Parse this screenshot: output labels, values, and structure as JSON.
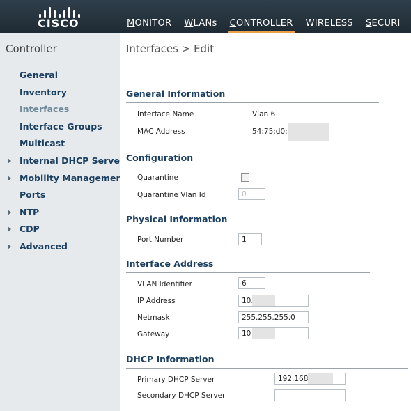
{
  "brand": {
    "name": "CISCO"
  },
  "nav": [
    {
      "label": "MONITOR",
      "accel": "M",
      "rest": "ONITOR"
    },
    {
      "label": "WLANs",
      "accel": "W",
      "rest": "LANs"
    },
    {
      "label": "CONTROLLER",
      "accel": "C",
      "rest": "ONTROLLER"
    },
    {
      "label": "WIRELESS",
      "accel": "W",
      "rest": "IRELESS",
      "accel_pos": "I"
    },
    {
      "label": "SECURI",
      "accel": "S",
      "rest": "ECURI"
    }
  ],
  "sidebar": {
    "title": "Controller",
    "items": [
      {
        "label": "General",
        "expandable": false
      },
      {
        "label": "Inventory",
        "expandable": false
      },
      {
        "label": "Interfaces",
        "expandable": false,
        "current": true
      },
      {
        "label": "Interface Groups",
        "expandable": false
      },
      {
        "label": "Multicast",
        "expandable": false
      },
      {
        "label": "Internal DHCP Server",
        "expandable": true
      },
      {
        "label": "Mobility Management",
        "expandable": true
      },
      {
        "label": "Ports",
        "expandable": false
      },
      {
        "label": "NTP",
        "expandable": true
      },
      {
        "label": "CDP",
        "expandable": true
      },
      {
        "label": "Advanced",
        "expandable": true
      }
    ]
  },
  "page": {
    "title": "Interfaces > Edit"
  },
  "general": {
    "heading": "General Information",
    "interface_name_label": "Interface Name",
    "interface_name_value": "Vlan 6",
    "mac_label": "MAC Address",
    "mac_value": "54:75:d0:"
  },
  "configuration": {
    "heading": "Configuration",
    "quarantine_label": "Quarantine",
    "quarantine_checked": false,
    "quarantine_vlan_label": "Quarantine Vlan Id",
    "quarantine_vlan_value": "0"
  },
  "physical": {
    "heading": "Physical Information",
    "port_label": "Port Number",
    "port_value": "1"
  },
  "address": {
    "heading": "Interface Address",
    "vlan_label": "VLAN Identifier",
    "vlan_value": "6",
    "ip_label": "IP Address",
    "ip_value": "10.",
    "netmask_label": "Netmask",
    "netmask_value": "255.255.255.0",
    "gateway_label": "Gateway",
    "gateway_value": "10"
  },
  "dhcp": {
    "heading": "DHCP Information",
    "primary_label": "Primary DHCP Server",
    "primary_value": "192.168",
    "secondary_label": "Secondary DHCP Server",
    "secondary_value": ""
  },
  "colors": {
    "topbar": "#2f3f4b",
    "active_tab_underline": "#e8a04a",
    "sidebar_bg": "#e6eaed",
    "link": "#1b3f5f"
  }
}
